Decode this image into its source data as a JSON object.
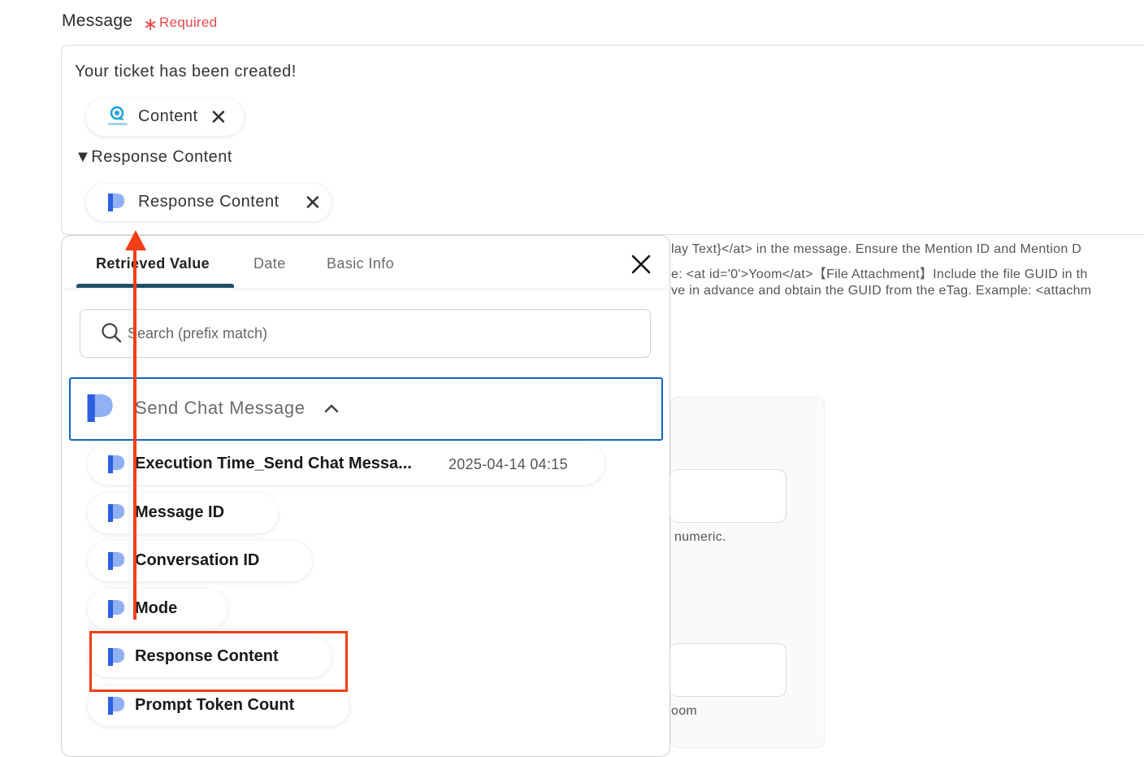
{
  "field": {
    "label": "Message",
    "required_star": "∗",
    "required_text": "Required"
  },
  "message": {
    "intro_text": "Your ticket has been created!",
    "chip1_label": "Content",
    "section_heading": "▼Response Content",
    "chip2_label": "Response Content",
    "close_glyph": "✕"
  },
  "help_text": {
    "line1": "lay Text}</at> in the message. Ensure the Mention ID and Mention D",
    "line2": "e: <at id='0'>Yoom</at>【File Attachment】Include the file GUID in th",
    "line3": "ve in advance and obtain the GUID from the eTag. Example: <attachm"
  },
  "background": {
    "hint1": "numeric.",
    "hint2": "oom"
  },
  "popup": {
    "tabs": [
      "Retrieved Value",
      "Date",
      "Basic Info"
    ],
    "active_tab": "Retrieved Value",
    "search_placeholder": "Search (prefix match)",
    "group_title": "Send Chat Message",
    "items": [
      {
        "label": "Execution Time_Send Chat Messa...",
        "value": "2025-04-14 04:15"
      },
      {
        "label": "Message ID",
        "value": ""
      },
      {
        "label": "Conversation ID",
        "value": ""
      },
      {
        "label": "Mode",
        "value": ""
      },
      {
        "label": "Response Content",
        "value": ""
      },
      {
        "label": "Prompt Token Count",
        "value": ""
      }
    ]
  },
  "annotation": {
    "highlighted_item": "Response Content",
    "color": "#f03e16"
  },
  "colors": {
    "tab_underline": "#1c4f66",
    "group_border": "#1565c0",
    "required": "#e5484d"
  },
  "icons": [
    "chatplus-logo-icon",
    "perplexity-logo-icon",
    "close-icon",
    "search-icon",
    "chevron-up-icon"
  ]
}
